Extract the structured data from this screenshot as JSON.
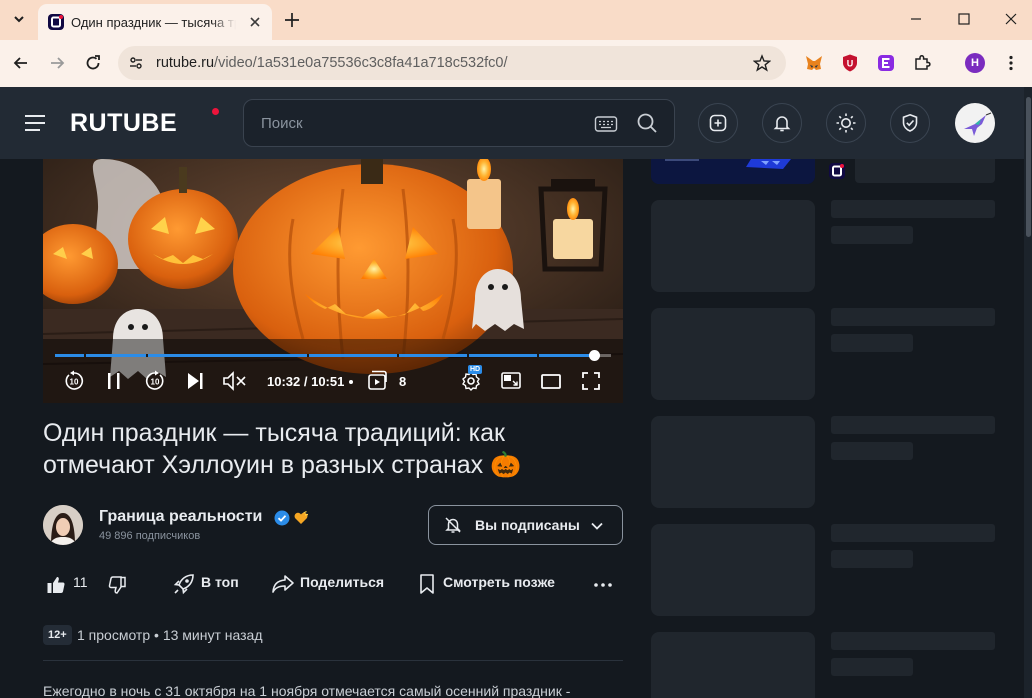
{
  "browser": {
    "tab_title": "Один праздник — тысяча трад",
    "url_domain": "rutube.ru",
    "url_path": "/video/1a531e0a75536c3c8fa41a718c532fc0/",
    "profile_initial": "H"
  },
  "site": {
    "logo_text": "RUTUBE",
    "search_placeholder": "Поиск"
  },
  "player": {
    "time_current": "10:32",
    "time_total": "10:51",
    "episode_count": "8",
    "quality_badge": "HD",
    "progress_fraction": 0.97
  },
  "video": {
    "title": "Один праздник — тысяча традиций: как отмечают Хэллоуин в разных странах 🎃",
    "channel_name": "Граница реальности",
    "subscribers": "49 896 подписчиков",
    "subscribe_label": "Вы подписаны",
    "likes": "11",
    "boost_label": "В топ",
    "share_label": "Поделиться",
    "watch_later_label": "Смотреть позже",
    "age_rating": "12+",
    "views": "1 просмотр",
    "published": "13 минут назад",
    "description": "Ежегодно в ночь с 31 октября на 1 ноября отмечается самый осенний праздник -"
  },
  "colors": {
    "accent_blue": "#2b8ce8",
    "brand_red": "#ed143b",
    "header_bg": "#222a34",
    "page_bg": "#14191f"
  }
}
